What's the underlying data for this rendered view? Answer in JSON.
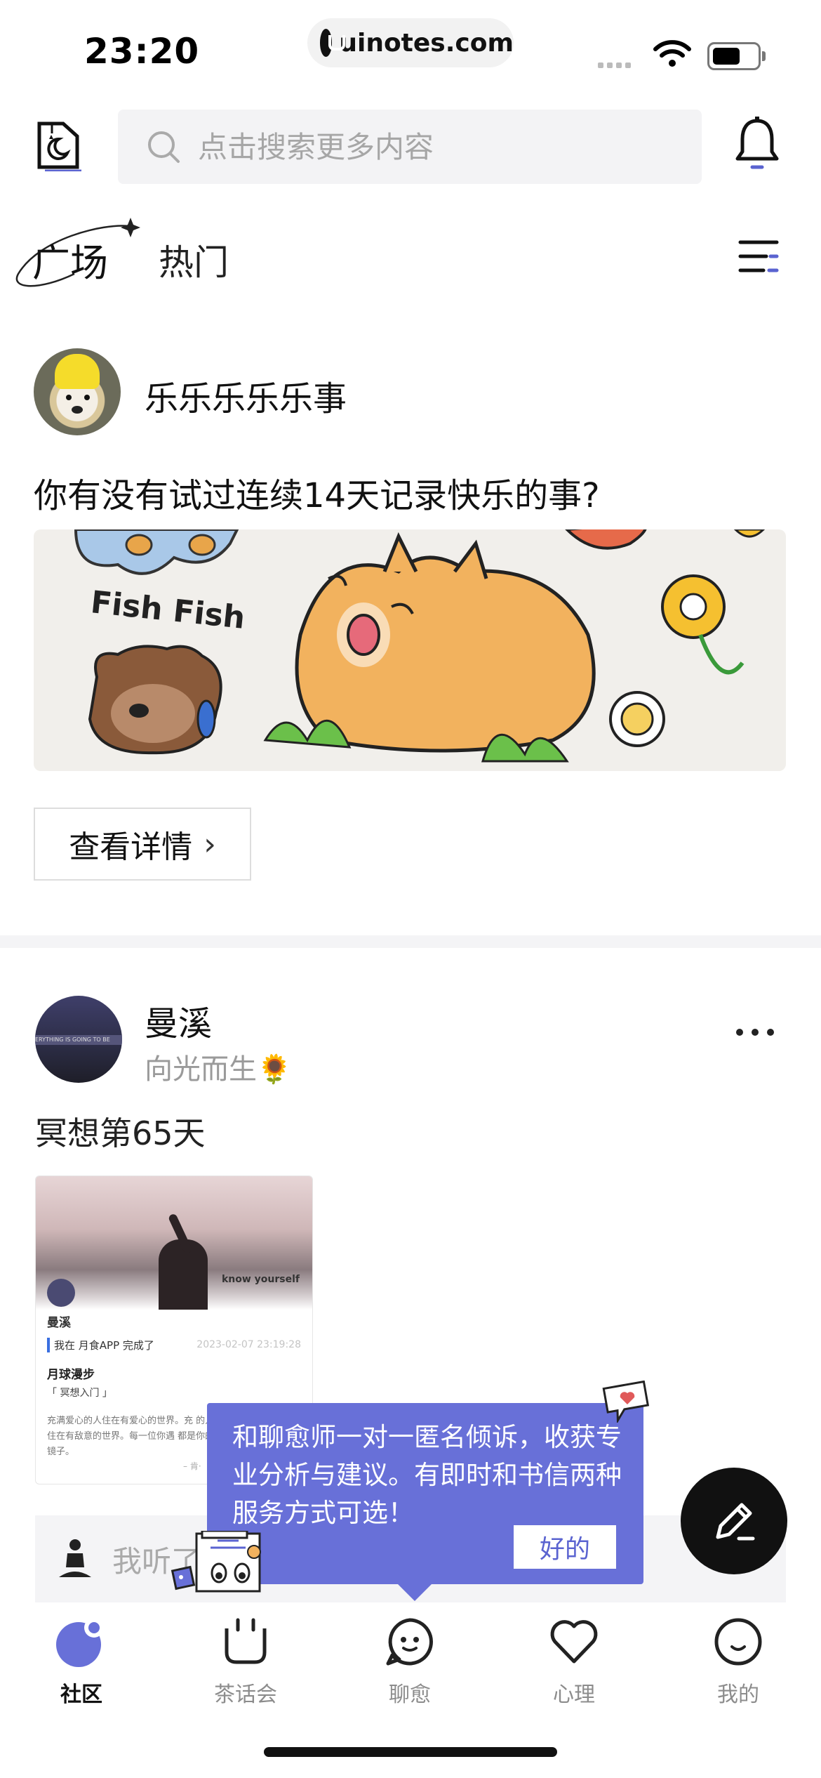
{
  "status_bar": {
    "time": "23:20",
    "url": "uinotes.com"
  },
  "header": {
    "search_placeholder": "点击搜索更多内容"
  },
  "tabs": {
    "guangchang": "广场",
    "hot": "热门"
  },
  "post1": {
    "username": "乐乐乐乐乐事",
    "text": "你有没有试过连续14天记录快乐的事?",
    "image_text": "Fish Fish",
    "detail_button": "查看详情"
  },
  "post2": {
    "username": "曼溪",
    "subtitle": "向光而生🌻",
    "text": "冥想第65天",
    "avatar_strip": "ERYTHING IS GOING TO BE",
    "card": {
      "name": "曼溪",
      "line1": "我在 月食APP 完成了",
      "date": "2023-02-07 23:19:28",
      "title": "月球漫步",
      "tag": "「 冥想入门 」",
      "paragraph": "充满爱心的人住在有爱心的世界。充 的人住在有敌意的世界。每一位你遇 都是你的镜子。",
      "signature": "– 肯·",
      "photo_text": "know yourself"
    },
    "comment_placeholder": "我听了"
  },
  "tooltip": {
    "text": "和聊愈师一对一匿名倾诉，收获专业分析与建议。有即时和书信两种服务方式可选！",
    "ok": "好的"
  },
  "tabbar": {
    "items": [
      {
        "label": "社区",
        "icon": "community-icon",
        "active": true
      },
      {
        "label": "茶话会",
        "icon": "tea-cup-icon",
        "active": false
      },
      {
        "label": "聊愈",
        "icon": "chat-face-icon",
        "active": false
      },
      {
        "label": "心理",
        "icon": "heart-icon",
        "active": false
      },
      {
        "label": "我的",
        "icon": "profile-face-icon",
        "active": false
      }
    ]
  },
  "colors": {
    "accent": "#6870d8",
    "text": "#111111",
    "muted": "#9a9a9a"
  }
}
